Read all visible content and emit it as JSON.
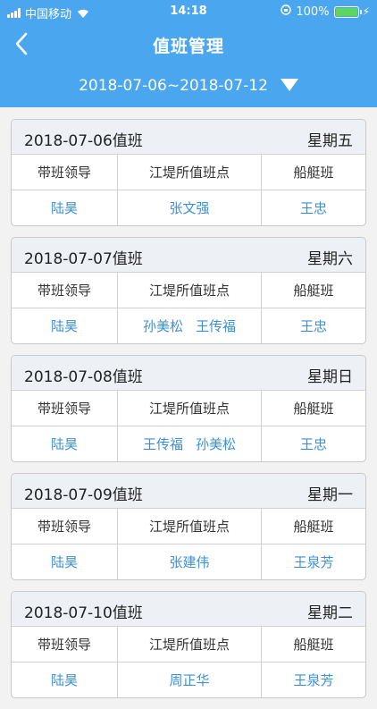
{
  "status_bar": {
    "carrier": "中国移动",
    "time": "14:18",
    "battery_percent": "100%"
  },
  "nav": {
    "title": "值班管理"
  },
  "date_filter": {
    "range": "2018-07-06~2018-07-12"
  },
  "columns": {
    "leader": "带班领导",
    "station": "江堤所值班点",
    "boat": "船艇班"
  },
  "duties": [
    {
      "date": "2018-07-06值班",
      "weekday": "星期五",
      "leader": "陆昊",
      "station": [
        "张文强"
      ],
      "boat": "王忠"
    },
    {
      "date": "2018-07-07值班",
      "weekday": "星期六",
      "leader": "陆昊",
      "station": [
        "孙美松",
        "王传福"
      ],
      "boat": "王忠"
    },
    {
      "date": "2018-07-08值班",
      "weekday": "星期日",
      "leader": "陆昊",
      "station": [
        "王传福",
        "孙美松"
      ],
      "boat": "王忠"
    },
    {
      "date": "2018-07-09值班",
      "weekday": "星期一",
      "leader": "陆昊",
      "station": [
        "张建伟"
      ],
      "boat": "王泉芳"
    },
    {
      "date": "2018-07-10值班",
      "weekday": "星期二",
      "leader": "陆昊",
      "station": [
        "周正华"
      ],
      "boat": "王泉芳"
    }
  ],
  "colors": {
    "primary": "#4aa6ee",
    "link": "#3b8fd9",
    "header_bg": "#edf0f5"
  }
}
